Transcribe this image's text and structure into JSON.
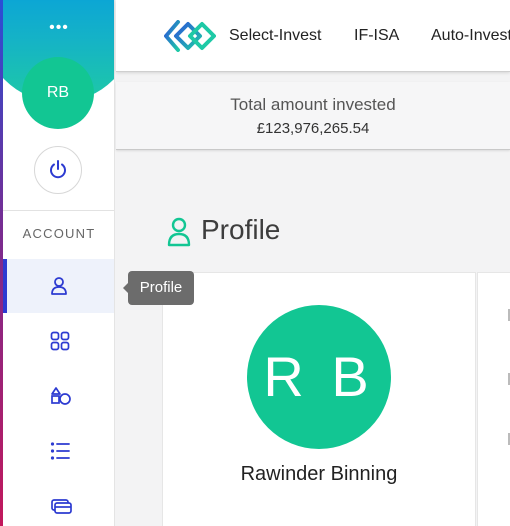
{
  "sidebar": {
    "menu_dots": "•••",
    "avatar_initials": "RB",
    "section_label": "ACCOUNT",
    "items": [
      {
        "name": "profile",
        "icon": "user-icon",
        "active": true
      },
      {
        "name": "dashboard",
        "icon": "grid-icon",
        "active": false
      },
      {
        "name": "portfolio",
        "icon": "shapes-icon",
        "active": false
      },
      {
        "name": "list",
        "icon": "list-icon",
        "active": false
      },
      {
        "name": "payments",
        "icon": "card-icon",
        "active": false
      }
    ]
  },
  "tooltip": {
    "text": "Profile"
  },
  "topnav": {
    "links": [
      "Select-Invest",
      "IF-ISA",
      "Auto-Invest"
    ]
  },
  "summary": {
    "label": "Total amount invested",
    "value": "£123,976,265.54"
  },
  "profile": {
    "title": "Profile",
    "avatar_initials": "R B",
    "name": "Rawinder Binning"
  },
  "colors": {
    "accent_green": "#12c693",
    "accent_blue": "#2d3bd1",
    "gradient_top": "#0aa3d8",
    "gradient_bottom": "#1ec9a6"
  }
}
